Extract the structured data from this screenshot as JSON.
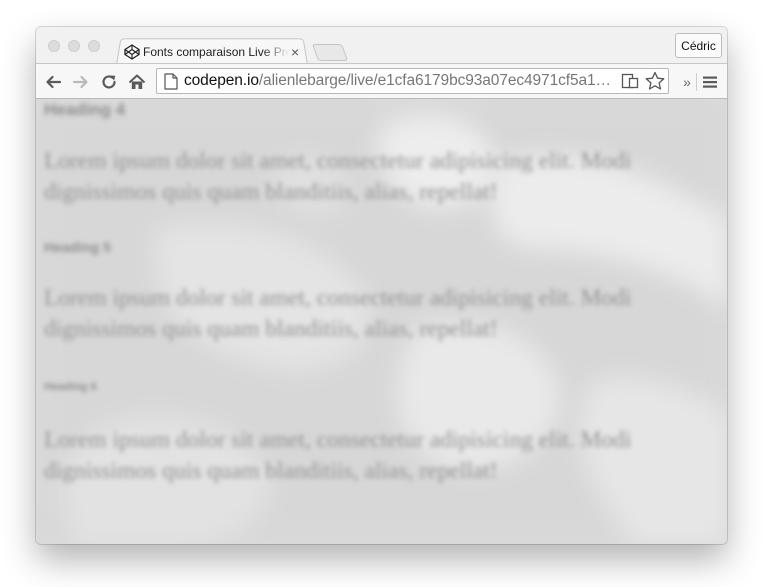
{
  "window": {
    "profile_name": "Cédric"
  },
  "tab": {
    "title": "Fonts comparaison Live Preview",
    "close_glyph": "×",
    "favicon": "codepen-icon"
  },
  "toolbar": {
    "back_icon": "back-arrow-icon",
    "forward_icon": "forward-arrow-icon",
    "reload_icon": "reload-icon",
    "home_icon": "home-icon",
    "overflow_glyph": "»",
    "menu_icon": "hamburger-menu-icon"
  },
  "omnibox": {
    "url_host": "codepen.io",
    "url_path": "/alienlebarge/live/e1cfa6179bc93a07ec4971cf5a145…",
    "page_icon": "page-icon",
    "reader_icon": "reader-mode-icon",
    "bookmark_icon": "star-icon"
  },
  "page": {
    "heading4": "Heading 4",
    "para1": "Lorem ipsum dolor sit amet, consectetur adipisicing elit. Modi dignissimos quis quam blanditiis, alias, repellat!",
    "heading5": "Heading 5",
    "para2": "Lorem ipsum dolor sit amet, consectetur adipisicing elit. Modi dignissimos quis quam blanditiis, alias, repellat!",
    "heading6": "Heading 6",
    "para3": "Lorem ipsum dolor sit amet, consectetur adipisicing elit. Modi dignissimos quis quam blanditiis, alias, repellat!"
  },
  "colors": {
    "page_background": "#dcdcdc",
    "text": "#8e8e8e",
    "chrome": "#f3f3f3"
  }
}
